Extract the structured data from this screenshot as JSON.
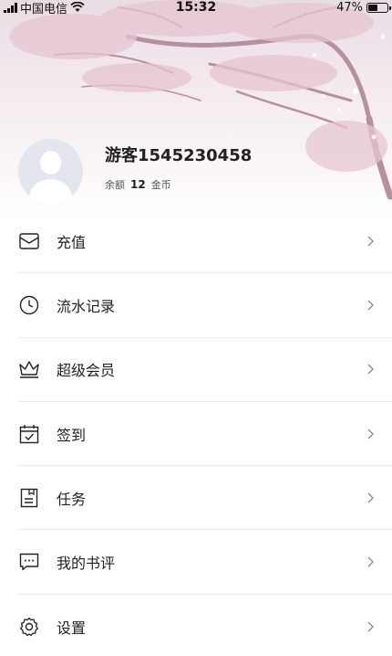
{
  "status_bar": {
    "carrier": "中国电信",
    "time": "15:32",
    "battery_text": "47%",
    "battery_level": 0.47
  },
  "profile": {
    "username": "游客1545230458",
    "balance_label": "余额",
    "balance_amount": "12",
    "balance_unit": "金币"
  },
  "menu": {
    "items": [
      {
        "label": "充值",
        "icon": "wallet-icon"
      },
      {
        "label": "流水记录",
        "icon": "clock-icon"
      },
      {
        "label": "超级会员",
        "icon": "crown-icon"
      },
      {
        "label": "签到",
        "icon": "calendar-check-icon"
      },
      {
        "label": "任务",
        "icon": "task-document-icon"
      },
      {
        "label": "我的书评",
        "icon": "comment-icon"
      },
      {
        "label": "设置",
        "icon": "gear-icon"
      }
    ]
  },
  "colors": {
    "accent_pink": "#e9dde4",
    "text": "#222222",
    "divider": "#ececec",
    "avatar_bg": "#e3e6ec"
  }
}
